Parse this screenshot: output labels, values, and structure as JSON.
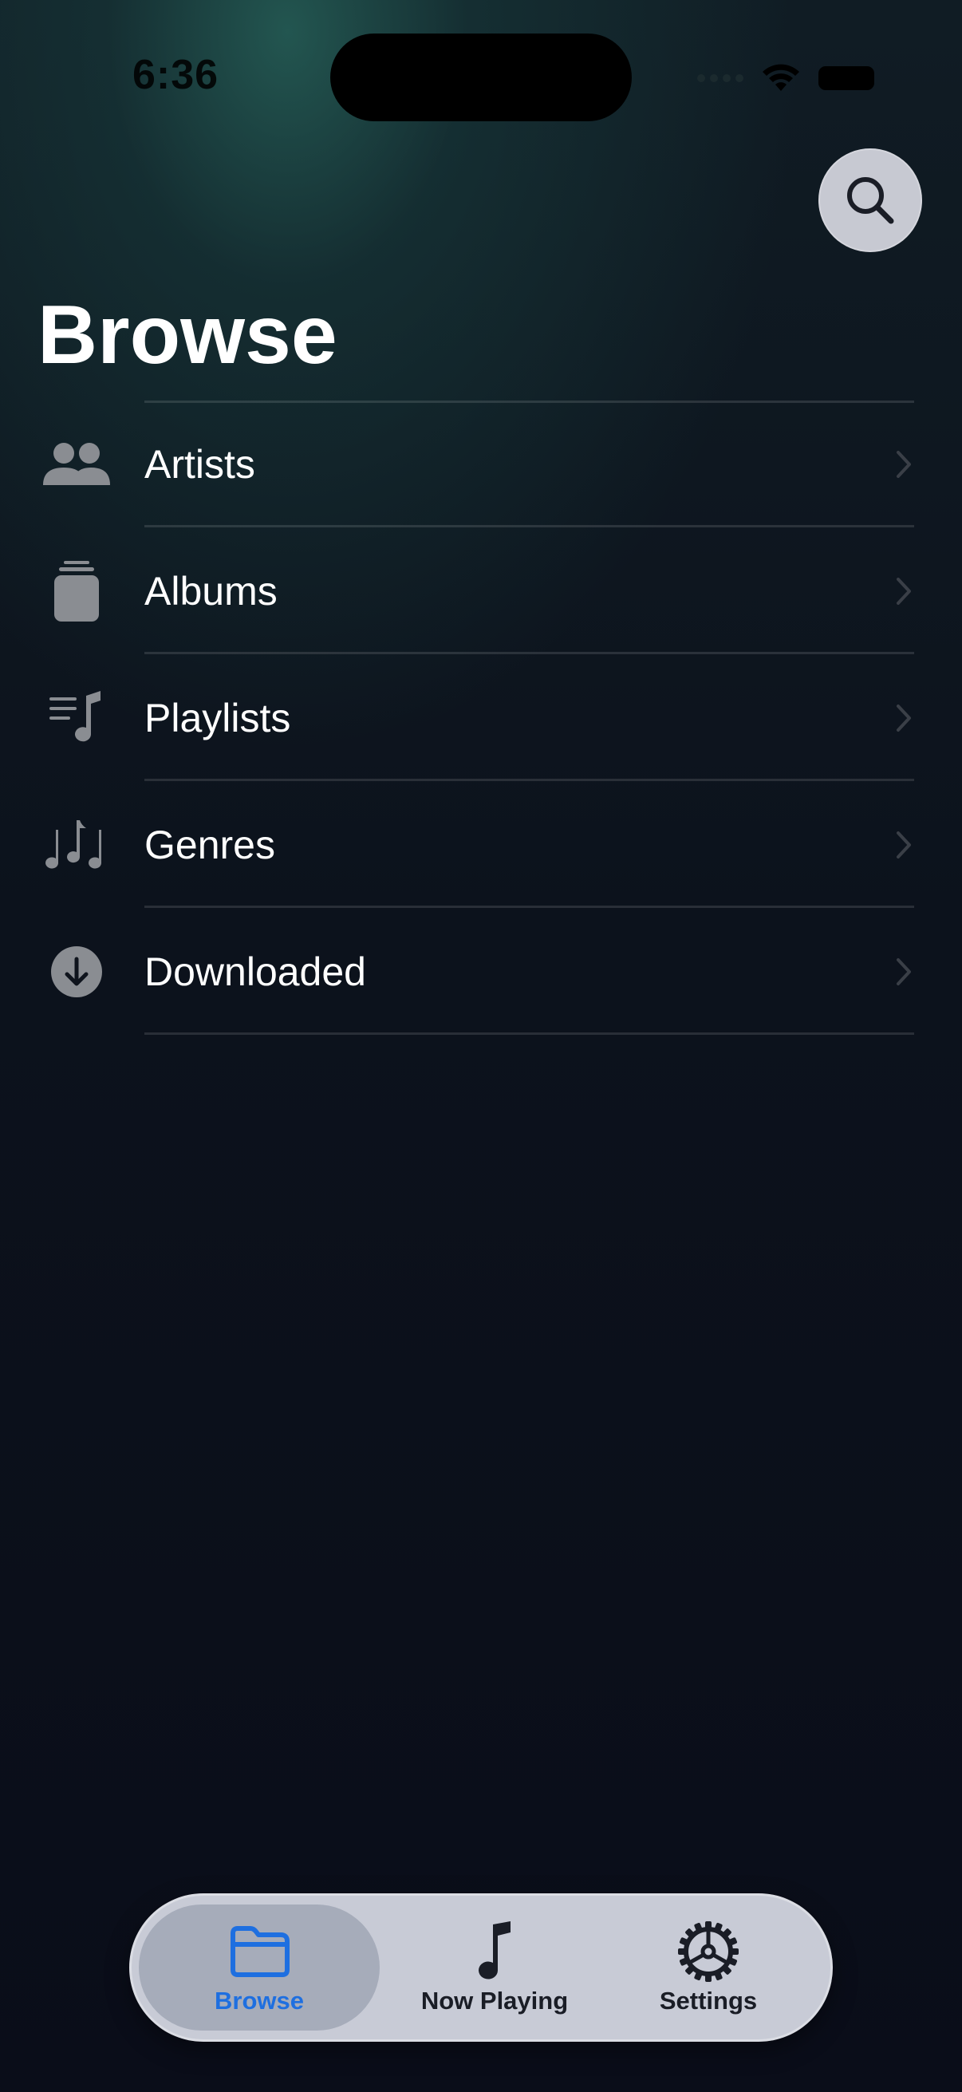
{
  "status_bar": {
    "time": "6:36"
  },
  "header": {
    "title": "Browse",
    "search_icon": "magnifying-glass-icon"
  },
  "browse_list": {
    "items": [
      {
        "label": "Artists",
        "icon": "person-2-fill-icon"
      },
      {
        "label": "Albums",
        "icon": "square-stack-icon"
      },
      {
        "label": "Playlists",
        "icon": "music-note-list-icon"
      },
      {
        "label": "Genres",
        "icon": "music-notes-icon"
      },
      {
        "label": "Downloaded",
        "icon": "arrow-down-circle-fill-icon"
      }
    ]
  },
  "tab_bar": {
    "tabs": [
      {
        "label": "Browse",
        "icon": "folder-icon",
        "selected": true
      },
      {
        "label": "Now Playing",
        "icon": "music-note-icon",
        "selected": false
      },
      {
        "label": "Settings",
        "icon": "gear-icon",
        "selected": false
      }
    ]
  },
  "colors": {
    "accent": "#1e6fe0",
    "row_icon": "#8a8d92",
    "tab_bar_bg": "#c8cbd6"
  }
}
